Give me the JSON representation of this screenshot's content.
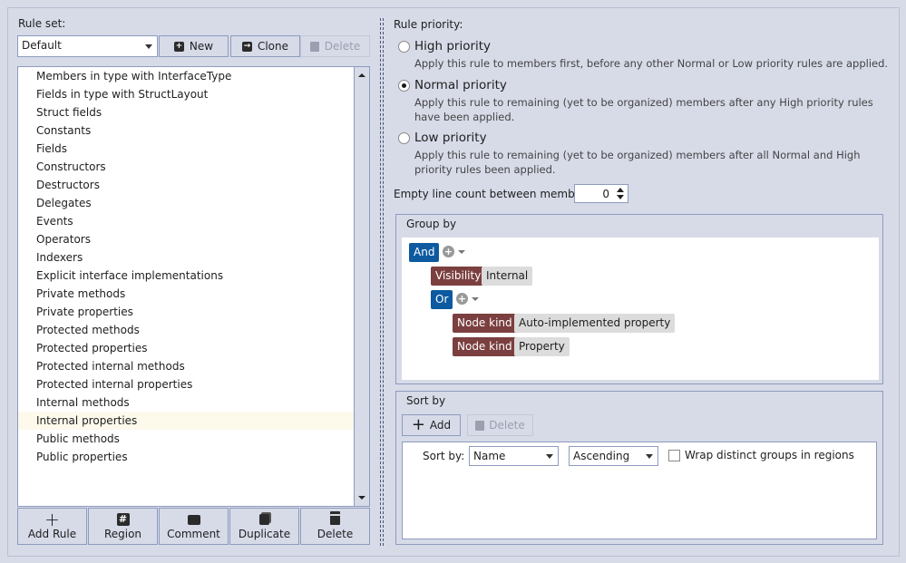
{
  "ruleset": {
    "label": "Rule set:",
    "selected": "Default",
    "buttons": {
      "new": "New",
      "clone": "Clone",
      "delete": "Delete"
    }
  },
  "rules": [
    "Members in type with InterfaceType",
    "Fields in type with StructLayout",
    "Struct fields",
    "Constants",
    "Fields",
    "Constructors",
    "Destructors",
    "Delegates",
    "Events",
    "Operators",
    "Indexers",
    "Explicit interface implementations",
    "Private methods",
    "Private properties",
    "Protected methods",
    "Protected properties",
    "Protected internal methods",
    "Protected internal properties",
    "Internal methods",
    "Internal properties",
    "Public methods",
    "Public properties"
  ],
  "selected_rule": "Internal properties",
  "bottom_buttons": {
    "add_rule": "Add Rule",
    "region": "Region",
    "comment": "Comment",
    "duplicate": "Duplicate",
    "delete": "Delete"
  },
  "priority": {
    "title": "Rule priority:",
    "selected": "normal",
    "options": {
      "high": {
        "label": "High priority",
        "desc": "Apply this rule to members first, before any other Normal or Low priority rules are applied."
      },
      "normal": {
        "label": "Normal priority",
        "desc": "Apply this rule to remaining (yet to be organized) members after any High priority rules have been applied."
      },
      "low": {
        "label": "Low priority",
        "desc": "Apply this rule to remaining (yet to be organized) members after all Normal and High priority rules been applied."
      }
    }
  },
  "empty_lines": {
    "label": "Empty line count between members:",
    "value": "0"
  },
  "group_by": {
    "title": "Group by",
    "root_op": "And",
    "visibility_key": "Visibility",
    "visibility_val": "Internal",
    "or_op": "Or",
    "cond1_key": "Node kind",
    "cond1_val": "Auto-implemented property",
    "cond2_key": "Node kind",
    "cond2_val": "Property"
  },
  "sort_by": {
    "title": "Sort by",
    "add": "Add",
    "delete": "Delete",
    "row_label": "Sort by:",
    "field": "Name",
    "order": "Ascending",
    "wrap_label": "Wrap distinct groups in regions",
    "wrap_checked": false
  },
  "colors": {
    "and_or": "#0d5aa0",
    "key_chip": "#7b3f3f",
    "value_chip": "#dcdcdc",
    "selected_row": "#fdfaec"
  }
}
